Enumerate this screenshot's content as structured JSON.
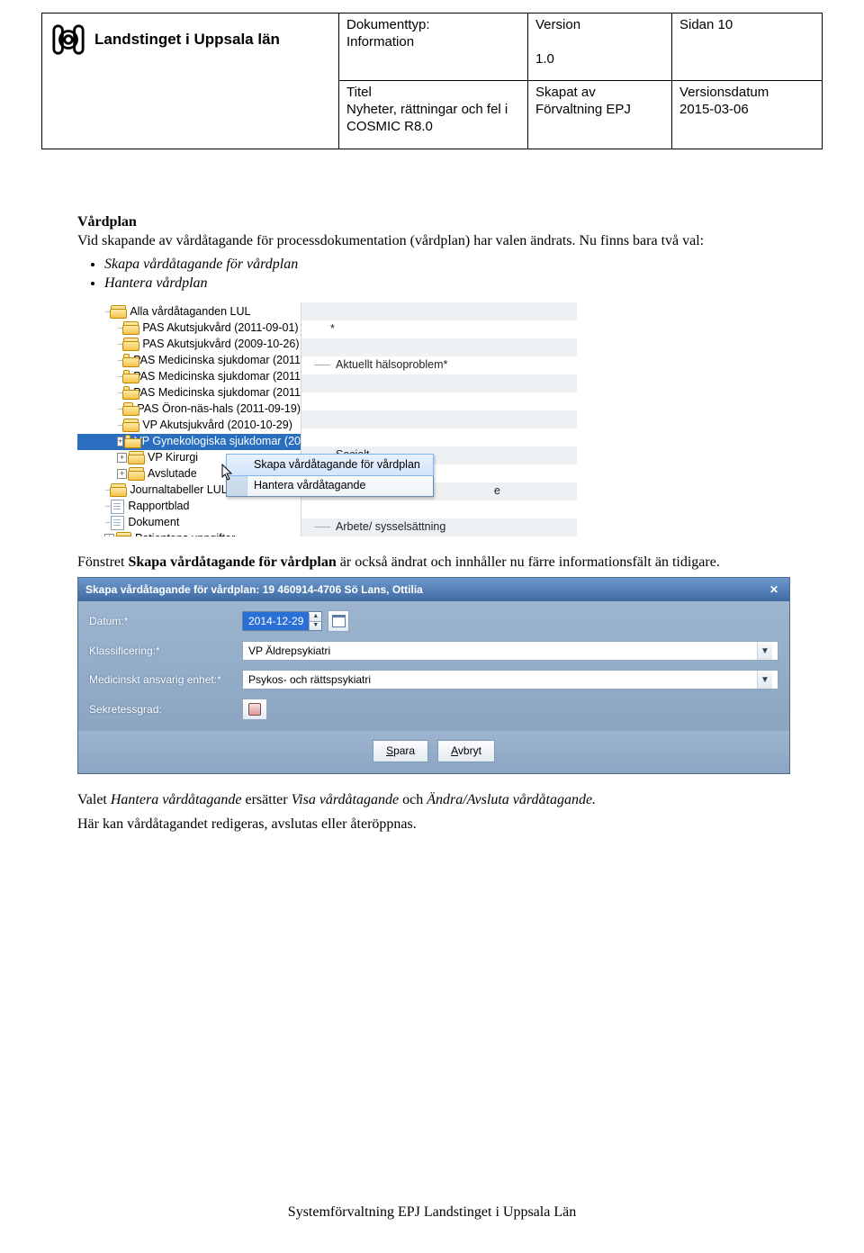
{
  "header": {
    "org": "Landstinget i Uppsala län",
    "col1": {
      "doctype_lbl": "Dokumenttyp:",
      "doctype": "Information",
      "title_lbl": "Titel",
      "title": "Nyheter, rättningar och fel i COSMIC R8.0"
    },
    "col2": {
      "version_lbl": "Version",
      "version": "1.0",
      "created_lbl": "Skapat av",
      "created": "Förvaltning EPJ"
    },
    "col3": {
      "page_lbl": "Sidan 10",
      "vdate_lbl": "Versionsdatum",
      "vdate": "2015-03-06"
    }
  },
  "body": {
    "h1": "Vårdplan",
    "p1": "Vid skapande av vårdåtagande för processdokumentation (vårdplan) har valen ändrats. Nu finns bara två val:",
    "bullets": [
      "Skapa vårdåtagande för vårdplan",
      "Hantera vårdplan"
    ],
    "p2a": "Fönstret ",
    "p2b": "Skapa vårdåtagande för vårdplan",
    "p2c": " är också ändrat och innhåller nu färre informationsfält än tidigare.",
    "p3a": "Valet ",
    "p3b": "Hantera vårdåtagande",
    "p3c": " ersätter ",
    "p3d": "Visa vårdåtagande",
    "p3e": " och ",
    "p3f": "Ändra/Avsluta vårdåtagande.",
    "p4": "Här kan vårdåtagandet redigeras, avslutas eller återöppnas."
  },
  "shot1": {
    "tree": [
      {
        "t": "Alla vårdåtaganden LUL",
        "ind": "ind2",
        "icon": "open"
      },
      {
        "t": "PAS Akutsjukvård (2011-09-01)",
        "ind": "ind3",
        "icon": "open"
      },
      {
        "t": "PAS Akutsjukvård (2009-10-26)",
        "ind": "ind3",
        "icon": "open"
      },
      {
        "t": "PAS Medicinska sjukdomar (2011",
        "ind": "ind3",
        "icon": "open"
      },
      {
        "t": "PAS Medicinska sjukdomar (2011",
        "ind": "ind3",
        "icon": "open"
      },
      {
        "t": "PAS Medicinska sjukdomar (2011",
        "ind": "ind3",
        "icon": "open"
      },
      {
        "t": "PAS Öron-näs-hals (2011-09-19)",
        "ind": "ind3",
        "icon": "open"
      },
      {
        "t": "VP Akutsjukvård (2010-10-29)",
        "ind": "ind3",
        "icon": "open"
      },
      {
        "t": "VP Gynekologiska sjukdomar (20",
        "ind": "ind3",
        "icon": "open",
        "sel": true,
        "plus": true
      },
      {
        "t": "VP Kirurgi",
        "ind": "ind3",
        "icon": "open",
        "plus": true
      },
      {
        "t": "Avslutade",
        "ind": "ind3",
        "icon": "open",
        "plus": true
      },
      {
        "t": "Journaltabeller LUL",
        "ind": "ind2",
        "icon": "open"
      },
      {
        "t": "Rapportblad",
        "ind": "ind2",
        "icon": "doc"
      },
      {
        "t": "Dokument",
        "ind": "ind2",
        "icon": "doc"
      },
      {
        "t": "Patientens uppgifter",
        "ind": "ind2",
        "icon": "open",
        "plus": true
      }
    ],
    "ctx": {
      "i1": "Skapa vårdåtagande för vårdplan",
      "i2": "Hantera vårdåtagande"
    },
    "right": {
      "star": "*",
      "r1": "Aktuellt hälsoproblem*",
      "r2": "Socialt",
      "r3": "e",
      "r4": "Arbete/ sysselsättning"
    }
  },
  "shot2": {
    "title": "Skapa vårdåtagande för vårdplan: 19 460914-4706 Sö Lans, Ottilia",
    "rows": {
      "date_lbl": "Datum:*",
      "date": "2014-12-29",
      "class_lbl": "Klassificering:*",
      "class": "VP Äldrepsykiatri",
      "unit_lbl": "Medicinskt ansvarig enhet:*",
      "unit": "Psykos- och rättspsykiatri",
      "sec_lbl": "Sekretessgrad:"
    },
    "btn_save": "Spara",
    "btn_cancel": "Avbryt"
  },
  "footer": "Systemförvaltning EPJ Landstinget i Uppsala Län"
}
